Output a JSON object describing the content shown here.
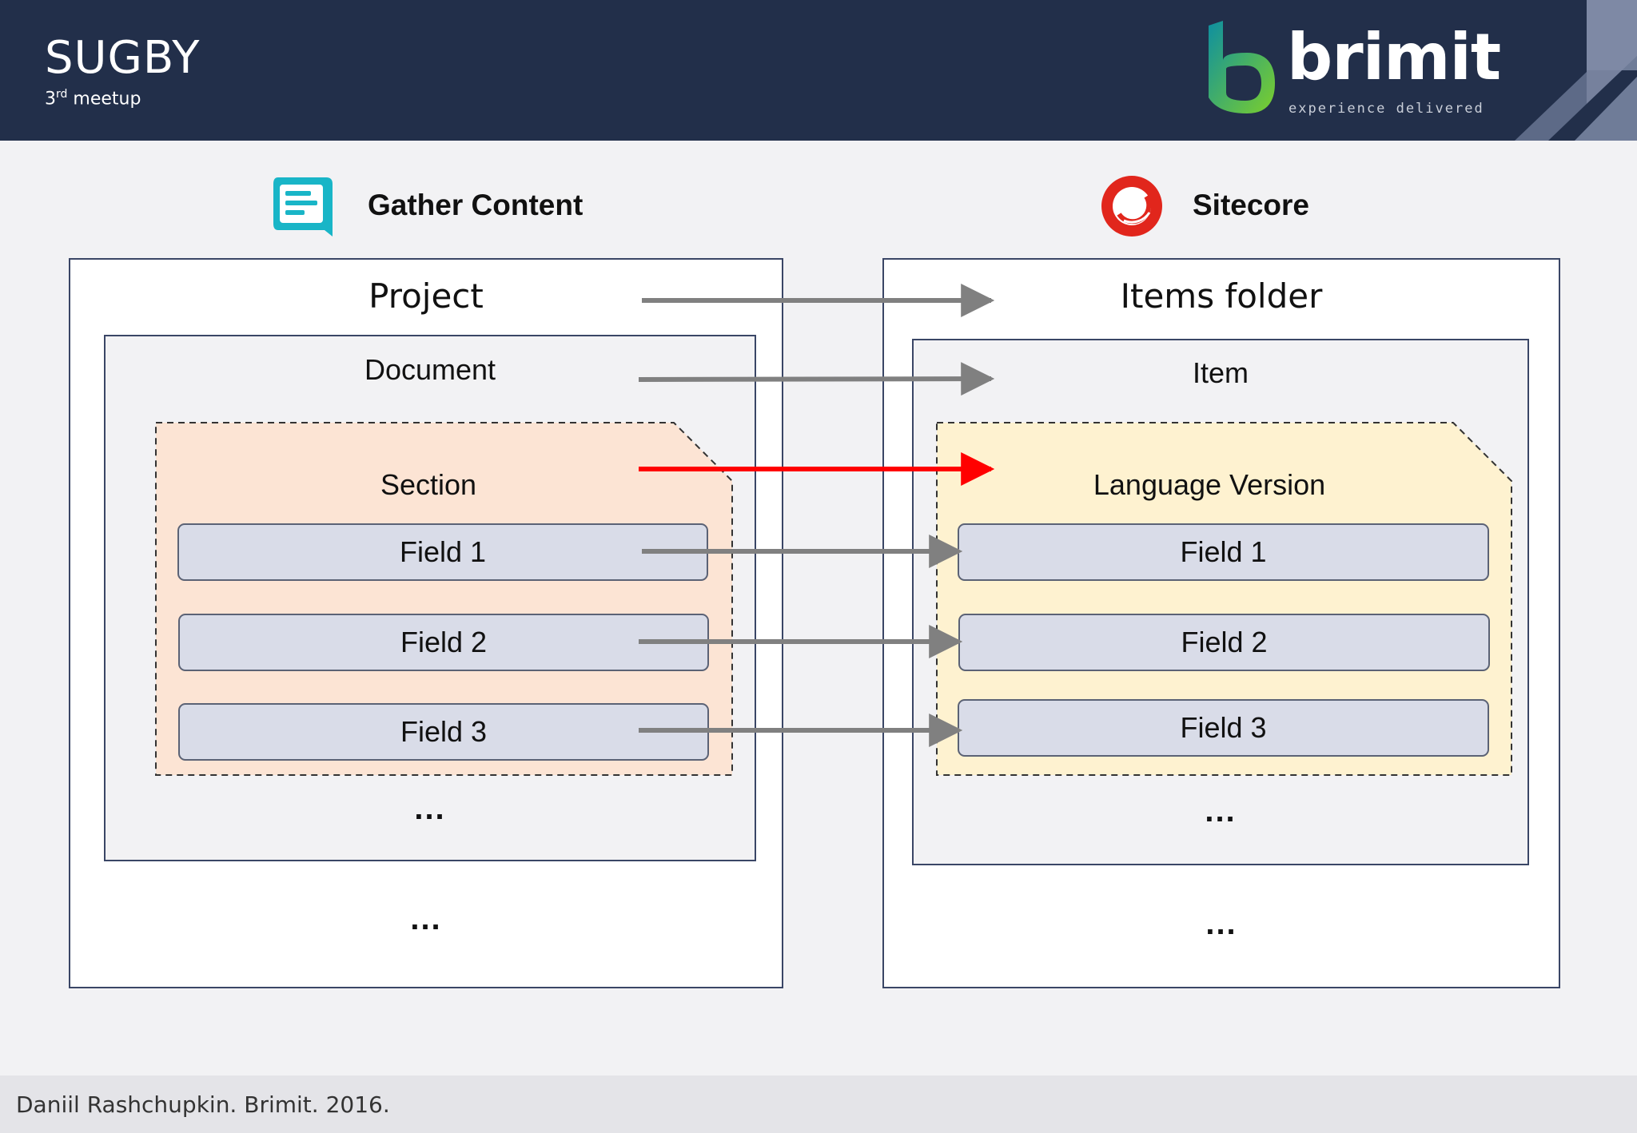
{
  "header": {
    "title": "SUGBY",
    "subtitle_number": "3",
    "subtitle_suffix": "rd",
    "subtitle_text": "meetup",
    "logo": {
      "wordmark": "brimit",
      "tagline": "experience delivered"
    }
  },
  "left": {
    "heading": "Gather Content",
    "icon": "gather-content-icon",
    "project": "Project",
    "document": "Document",
    "section": "Section",
    "fields": [
      "Field 1",
      "Field 2",
      "Field 3"
    ],
    "inner_more": "...",
    "outer_more": "..."
  },
  "right": {
    "heading": "Sitecore",
    "icon": "sitecore-icon",
    "folder": "Items folder",
    "item": "Item",
    "language_version": "Language Version",
    "fields": [
      "Field 1",
      "Field 2",
      "Field 3"
    ],
    "inner_more": "...",
    "outer_more": "..."
  },
  "mappings": [
    {
      "from": "Project",
      "to": "Items folder",
      "highlight": false
    },
    {
      "from": "Document",
      "to": "Item",
      "highlight": false
    },
    {
      "from": "Section",
      "to": "Language Version",
      "highlight": true
    },
    {
      "from": "Field 1",
      "to": "Field 1",
      "highlight": false
    },
    {
      "from": "Field 2",
      "to": "Field 2",
      "highlight": false
    },
    {
      "from": "Field 3",
      "to": "Field 3",
      "highlight": false
    }
  ],
  "colors": {
    "header_bg": "#222f4a",
    "arrow": "#808080",
    "arrow_highlight": "#ff0000",
    "section_fill": "#fce4d4",
    "language_fill": "#fef2d0",
    "field_fill": "#d9dce8",
    "gather_content": "#19b5c7",
    "sitecore": "#e1261c"
  },
  "footer": {
    "text": "Daniil Rashchupkin. Brimit. 2016."
  }
}
